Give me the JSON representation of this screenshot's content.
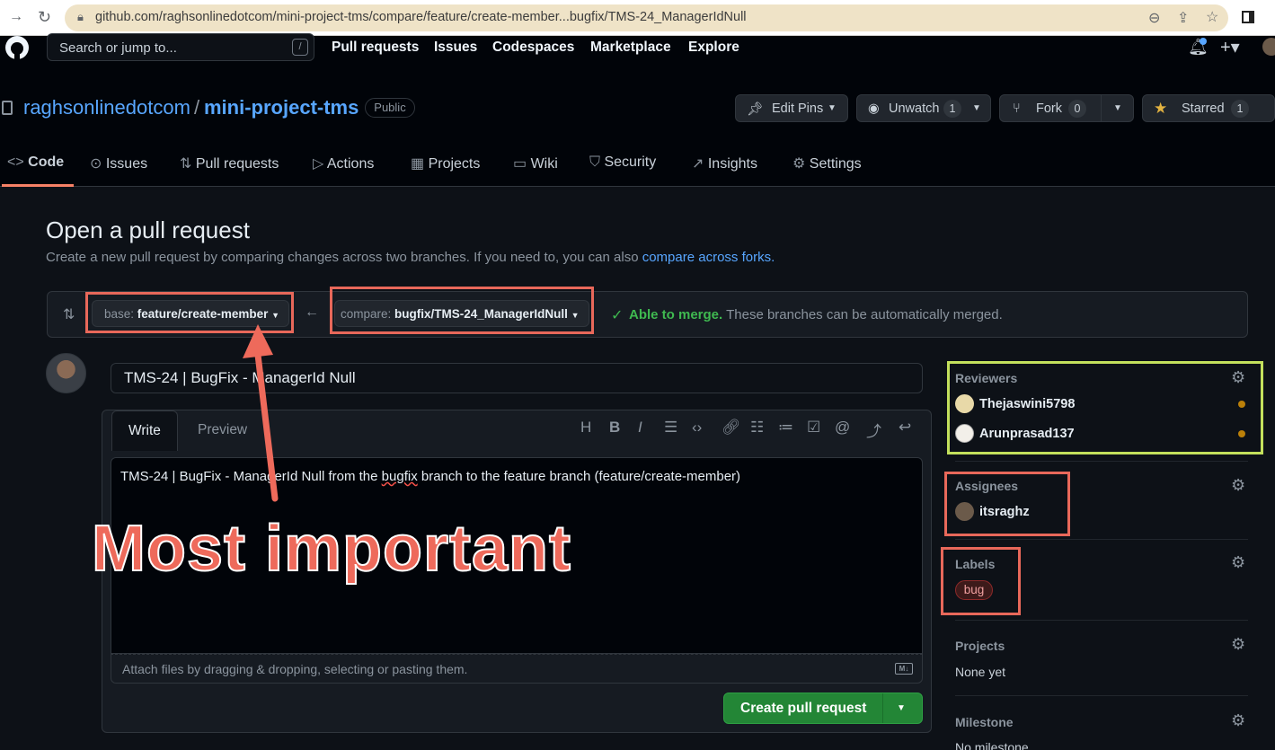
{
  "browser": {
    "url": "github.com/raghsonlinedotcom/mini-project-tms/compare/feature/create-member...bugfix/TMS-24_ManagerIdNull"
  },
  "header": {
    "search_placeholder": "Search or jump to...",
    "slash_hint": "/",
    "nav": [
      "Pull requests",
      "Issues",
      "Codespaces",
      "Marketplace",
      "Explore"
    ]
  },
  "repo": {
    "owner": "raghsonlinedotcom",
    "sep": "/",
    "name": "mini-project-tms",
    "visibility": "Public",
    "buttons": {
      "edit_pins": "Edit Pins",
      "unwatch": "Unwatch",
      "unwatch_count": "1",
      "fork": "Fork",
      "fork_count": "0",
      "starred": "Starred",
      "starred_count": "1"
    },
    "tabs": [
      "Code",
      "Issues",
      "Pull requests",
      "Actions",
      "Projects",
      "Wiki",
      "Security",
      "Insights",
      "Settings"
    ]
  },
  "compare": {
    "title": "Open a pull request",
    "subtitle": "Create a new pull request by comparing changes across two branches. If you need to, you can also",
    "subtitle_link": "compare across forks.",
    "base_prefix": "base:",
    "base_branch": "feature/create-member",
    "compare_prefix": "compare:",
    "compare_branch": "bugfix/TMS-24_ManagerIdNull",
    "merge_status": "Able to merge.",
    "merge_detail": "These branches can be automatically merged."
  },
  "form": {
    "title_value": "TMS-24 | BugFix - ManagerId Null",
    "tab_write": "Write",
    "tab_preview": "Preview",
    "body_before": "TMS-24 | BugFix - ManagerId Null from the ",
    "body_mark": "bugfix",
    "body_after": " branch to the feature branch (feature/create-member)",
    "attach_text": "Attach files by dragging & dropping, selecting or pasting them.",
    "md_badge": "M↓",
    "create_label": "Create pull request"
  },
  "sidebar": {
    "reviewers_title": "Reviewers",
    "reviewers": [
      "Thejaswini5798",
      "Arunprasad137"
    ],
    "assignees_title": "Assignees",
    "assignee": "itsraghz",
    "labels_title": "Labels",
    "label": "bug",
    "projects_title": "Projects",
    "projects_value": "None yet",
    "milestone_title": "Milestone",
    "milestone_value": "No milestone"
  },
  "annotation": {
    "text": "Most important"
  },
  "colors": {
    "accent_link": "#58a6ff",
    "success": "#3fb950",
    "primary_button": "#238636",
    "annotation_red": "#e8685a",
    "annotation_green": "#c3e05c"
  }
}
